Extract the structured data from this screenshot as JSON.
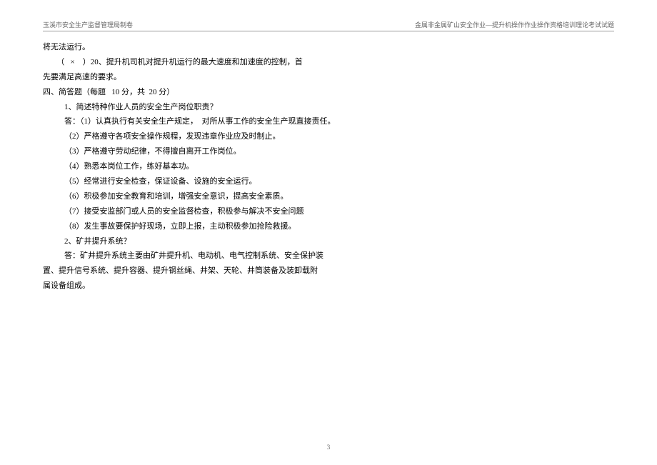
{
  "header": {
    "left": "玉溪市安全生产监督管理局制卷",
    "right": "金属非金属矿山安全作业—提升机操作作业操作资格培训理论考试试题"
  },
  "content": {
    "line1": "将无法运行。",
    "line2": "       （   ×    ）20、提升机司机对提升机运行的最大速度和加速度的控制，首",
    "line3": "先要满足高速的要求。",
    "section4_title": "四、简答题（每题   10 分，共  20 分）",
    "q1": "1、简述特种作业人员的安全生产岗位职责？",
    "a1_1": "答：（1）认真执行有关安全生产规定，  对所从事工作的安全生产现直接责任。",
    "a1_2": "（2）严格遵守各项安全操作规程，发现违章作业应及时制止。",
    "a1_3": "（3）严格遵守劳动纪律，不得擅自离开工作岗位。",
    "a1_4": "（4）熟悉本岗位工作，练好基本功。",
    "a1_5": "（5）经常进行安全检查，保证设备、设施的安全运行。",
    "a1_6": "（6）积极参加安全教育和培训，增强安全意识，提高安全素质。",
    "a1_7": "（7）接受安监部门或人员的安全监督检查，积极参与解决不安全问题",
    "a1_8": "（8）发生事故要保护好现场，立即上报，主动积极参加抢险救援。",
    "q2": "2、矿井提升系统？",
    "a2_1": "答：矿井提升系统主要由矿井提升机、电动机、电气控制系统、安全保护装",
    "a2_2": "置、提升信号系统、提升容器、提升钢丝绳、井架、天轮、井筒装备及装卸载附",
    "a2_3": "属设备组成。"
  },
  "pageNumber": "3"
}
